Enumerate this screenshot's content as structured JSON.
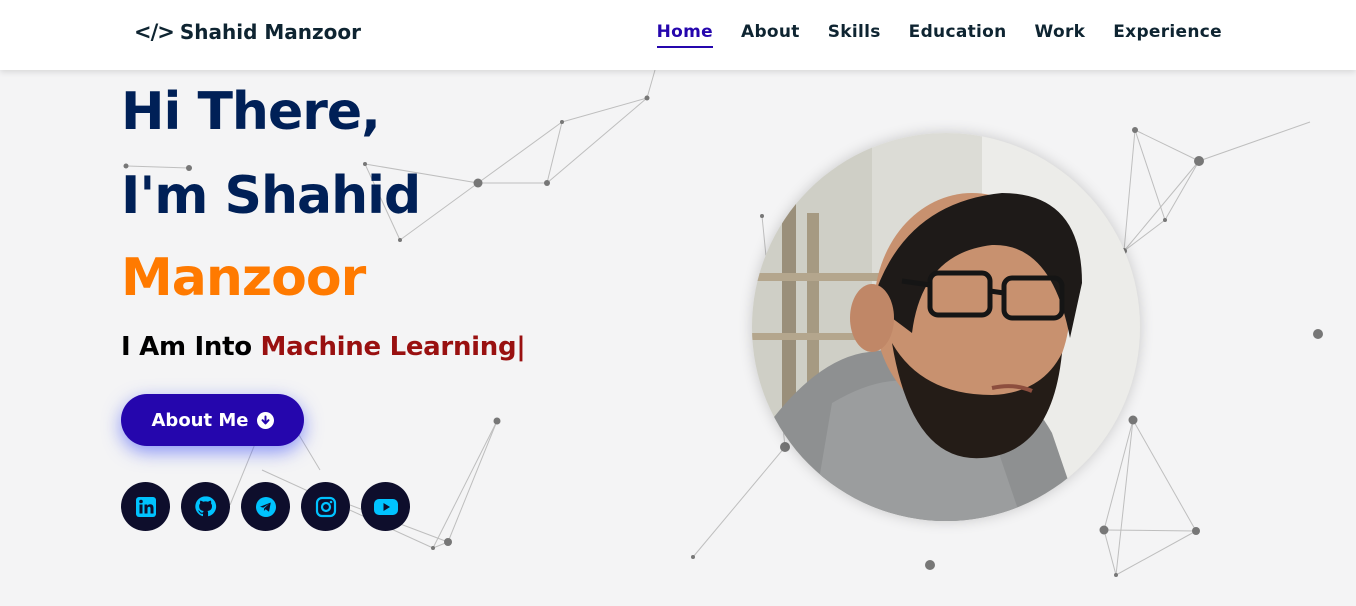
{
  "nav": {
    "brand_icon": "</>",
    "brand_name": "Shahid Manzoor",
    "items": [
      {
        "label": "Home",
        "active": true
      },
      {
        "label": "About",
        "active": false
      },
      {
        "label": "Skills",
        "active": false
      },
      {
        "label": "Education",
        "active": false
      },
      {
        "label": "Work",
        "active": false
      },
      {
        "label": "Experience",
        "active": false
      }
    ]
  },
  "hero": {
    "line1": "Hi There,",
    "line2": "I'm Shahid",
    "line3": "Manzoor",
    "typing_prefix": "I Am Into ",
    "typing_role": "Machine Learning",
    "typing_cursor": "|",
    "cta_label": "About Me",
    "cta_icon": "arrow-down-circle-icon",
    "socials": [
      "linkedin-icon",
      "github-icon",
      "telegram-icon",
      "instagram-icon",
      "youtube-icon"
    ],
    "photo_icon": "profile-photo"
  },
  "colors": {
    "primary_text": "#002057",
    "accent_orange": "#ff7a00",
    "role_red": "#991010",
    "button_bg": "#2506ad",
    "nav_active": "#2506ad",
    "social_bg": "#0e0e2c",
    "social_icon": "#00c3ff"
  }
}
